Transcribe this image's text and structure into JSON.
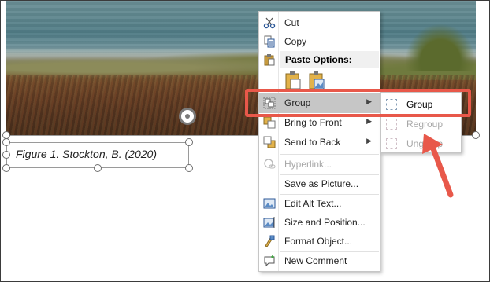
{
  "caption": "Figure 1. Stockton, B. (2020)",
  "menu": {
    "cut": "Cut",
    "copy": "Copy",
    "paste_options": "Paste Options:",
    "group": "Group",
    "bring_to_front": "Bring to Front",
    "send_to_back": "Send to Back",
    "hyperlink": "Hyperlink...",
    "save_as_picture": "Save as Picture...",
    "edit_alt_text": "Edit Alt Text...",
    "size_and_position": "Size and Position...",
    "format_object": "Format Object...",
    "new_comment": "New Comment"
  },
  "submenu": {
    "group": "Group",
    "regroup": "Regroup",
    "ungroup": "Ungroup"
  },
  "colors": {
    "highlight": "#e8584a",
    "menu_hover": "#c6c6c6"
  }
}
